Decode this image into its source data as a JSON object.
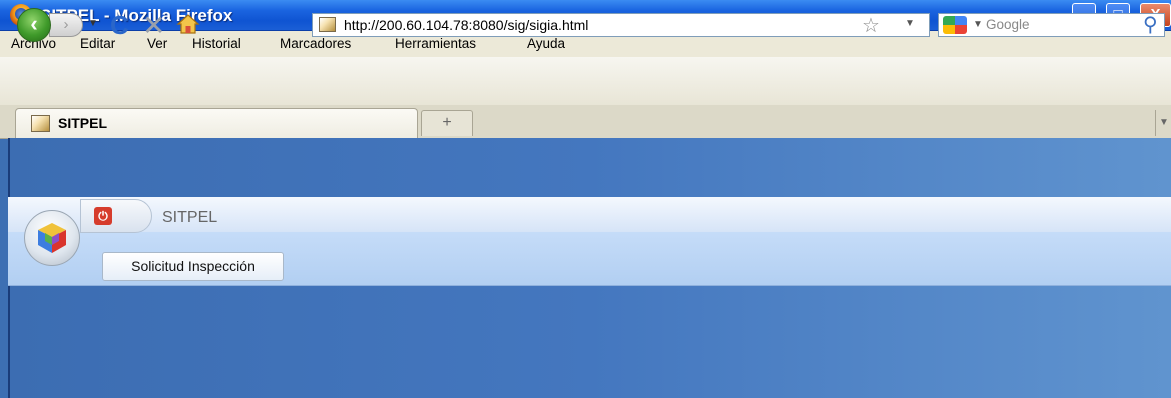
{
  "window": {
    "title": "SITPEL - Mozilla Firefox",
    "controls": {
      "minimize": "_",
      "maximize": "□",
      "close": "X"
    }
  },
  "menubar": {
    "items": [
      "Archivo",
      "Editar",
      "Ver",
      "Historial",
      "Marcadores",
      "Herramientas",
      "Ayuda"
    ]
  },
  "navbar": {
    "back_icon": "‹",
    "forward_icon": "›",
    "reload_icon": "C",
    "stop_icon": "✕",
    "url": "http://200.60.104.78:8080/sig/sigia.html",
    "search_placeholder": "Google"
  },
  "tabs": {
    "active_label": "SITPEL",
    "new_tab_icon": "+"
  },
  "app": {
    "name": "SITPEL",
    "toolbar_button": "Solicitud Inspección"
  },
  "colors": {
    "title_bar": "#1a64e0",
    "app_background": "#4477bf",
    "app_toolbar": "#c5dcf8"
  }
}
